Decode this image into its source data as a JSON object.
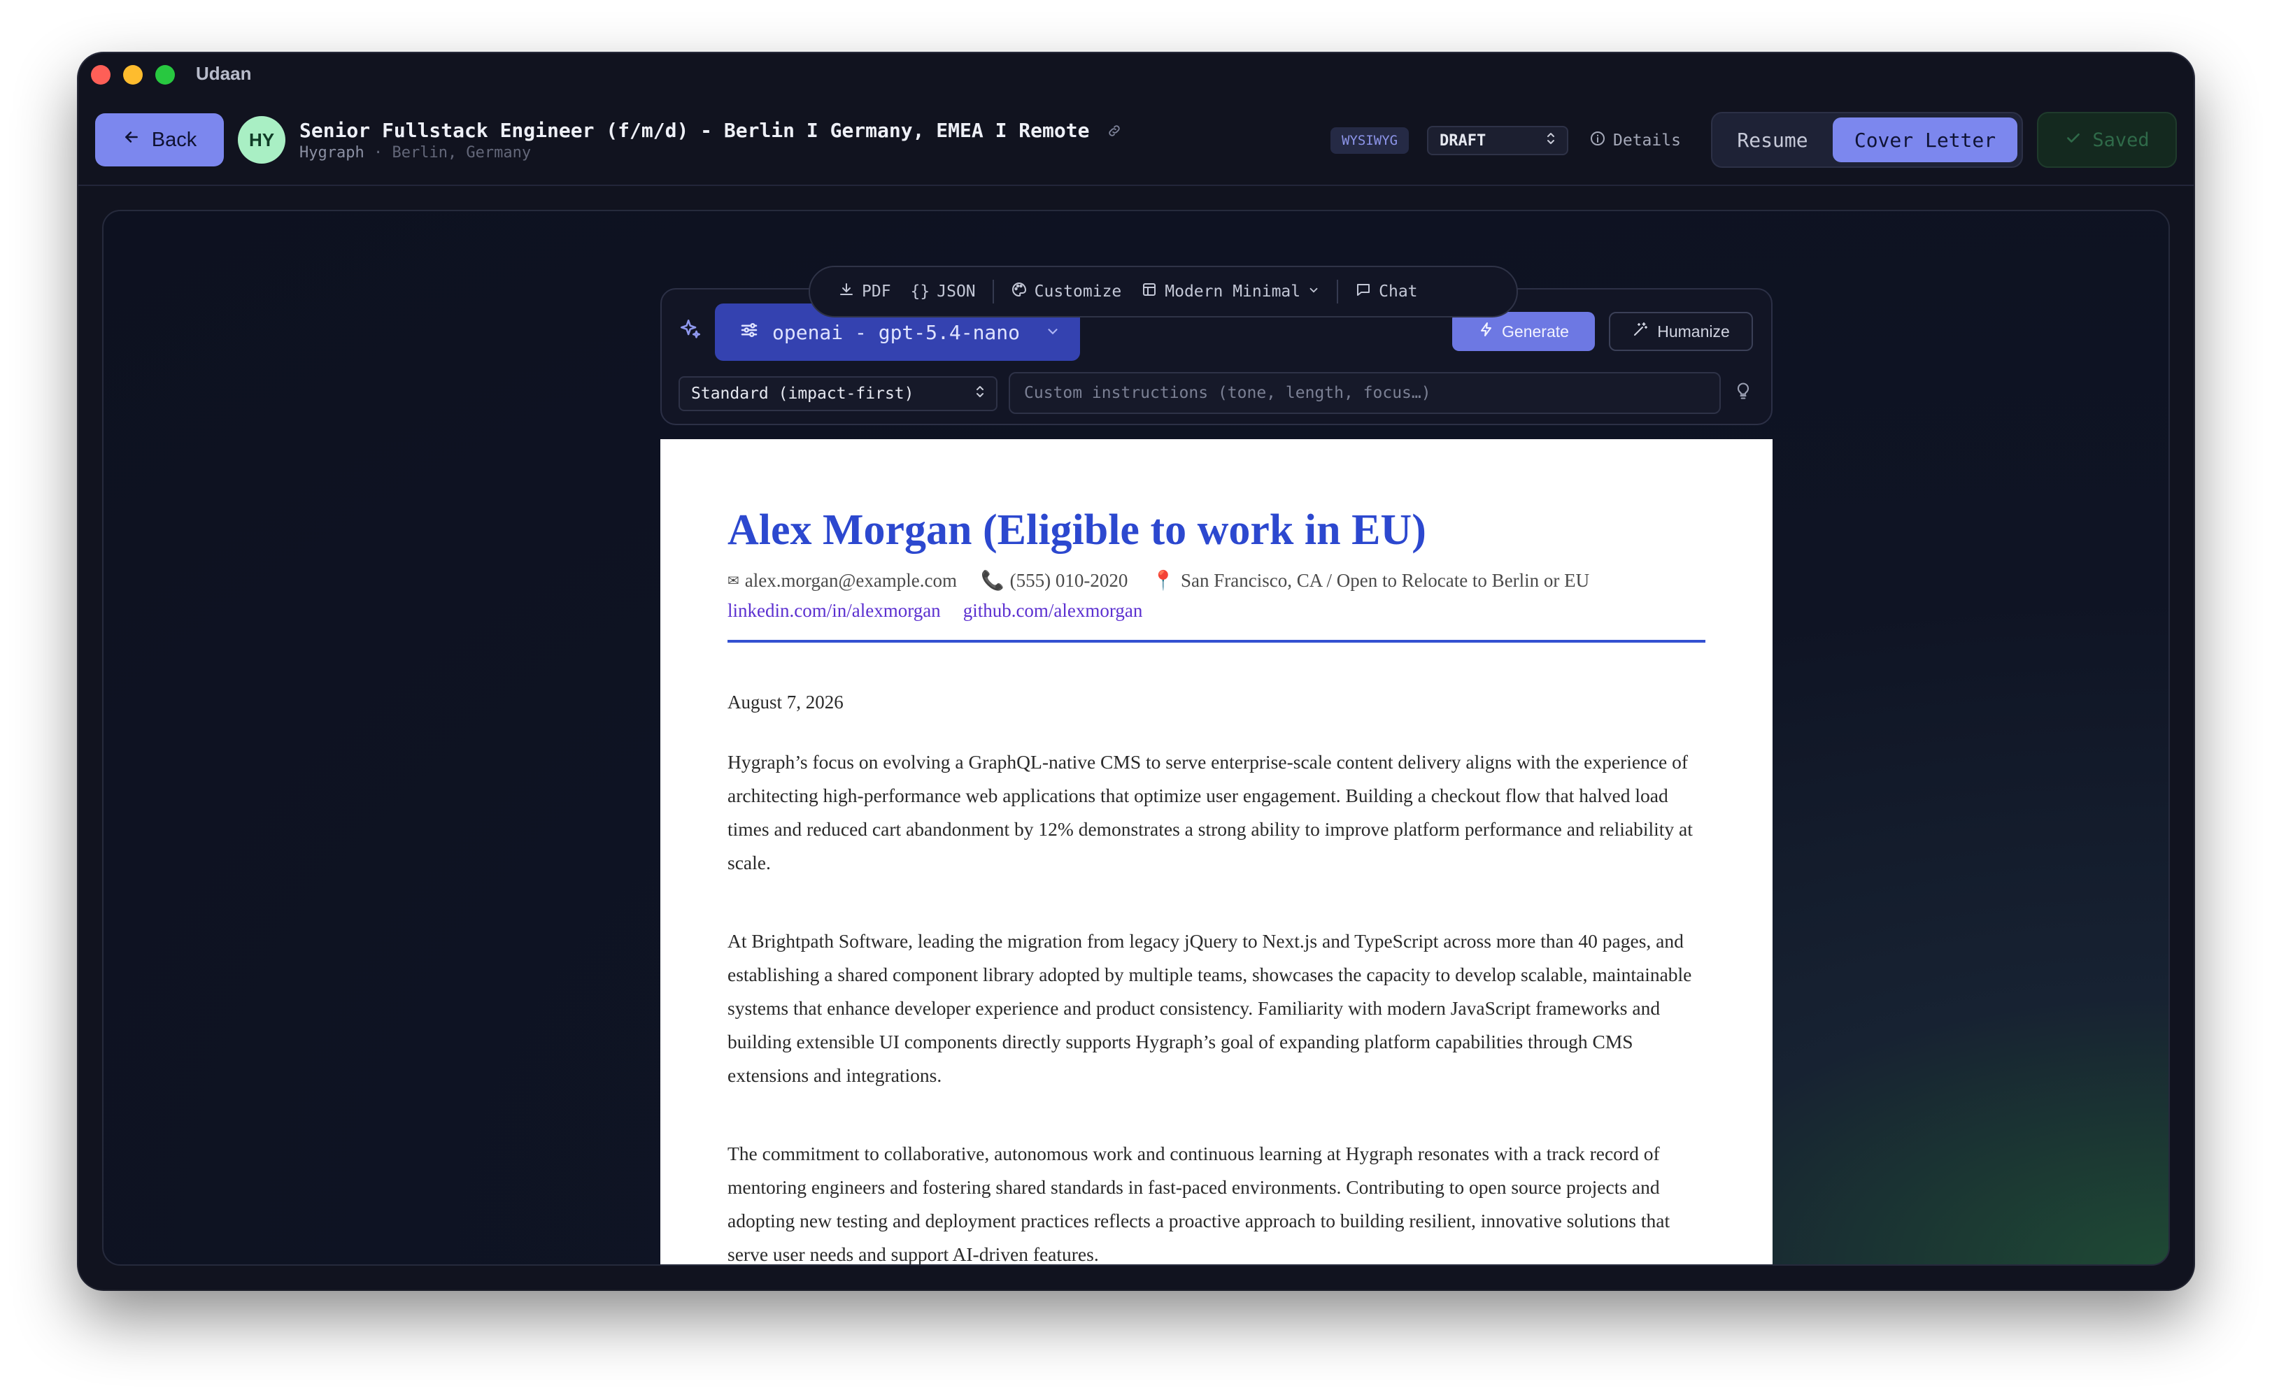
{
  "app": {
    "title": "Udaan"
  },
  "header": {
    "back_label": "Back",
    "avatar_initials": "HY",
    "job_title": "Senior Fullstack Engineer (f/m/d) - Berlin I Germany, EMEA I Remote",
    "company": "Hygraph",
    "location": "Berlin, Germany",
    "editor_mode": "WYSIWYG",
    "status": "DRAFT",
    "details_label": "Details",
    "tabs": [
      {
        "label": "Resume",
        "active": false
      },
      {
        "label": "Cover Letter",
        "active": true
      }
    ],
    "saved_label": "Saved"
  },
  "toolbar": {
    "pdf_label": "PDF",
    "json_label": "JSON",
    "customize_label": "Customize",
    "template_label": "Modern Minimal",
    "chat_label": "Chat"
  },
  "generator": {
    "model_label": "openai - gpt-5.4-nano",
    "generate_label": "Generate",
    "humanize_label": "Humanize",
    "style": "Standard (impact-first)",
    "instructions_placeholder": "Custom instructions (tone, length, focus…)"
  },
  "letter": {
    "name": "Alex Morgan (Eligible to work in EU)",
    "email": "alex.morgan@example.com",
    "phone": "(555) 010-2020",
    "location": "San Francisco, CA / Open to Relocate to Berlin or EU",
    "linkedin": "linkedin.com/in/alexmorgan",
    "github": "github.com/alexmorgan",
    "date": "August 7, 2026",
    "paragraphs": [
      "Hygraph’s focus on evolving a GraphQL-native CMS to serve enterprise-scale content delivery aligns with the experience of architecting high-performance web applications that optimize user engagement. Building a checkout flow that halved load times and reduced cart abandonment by 12% demonstrates a strong ability to improve platform performance and reliability at scale.",
      "At Brightpath Software, leading the migration from legacy jQuery to Next.js and TypeScript across more than 40 pages, and establishing a shared component library adopted by multiple teams, showcases the capacity to develop scalable, maintainable systems that enhance developer experience and product consistency. Familiarity with modern JavaScript frameworks and building extensible UI components directly supports Hygraph’s goal of expanding platform capabilities through CMS extensions and integrations.",
      "The commitment to collaborative, autonomous work and continuous learning at Hygraph resonates with a track record of mentoring engineers and fostering shared standards in fast-paced environments. Contributing to open source projects and adopting new testing and deployment practices reflects a proactive approach to building resilient, innovative solutions that serve user needs and support AI-driven features."
    ]
  },
  "icons": {
    "email": "✉",
    "phone": "📞",
    "location": "📍"
  },
  "colors": {
    "accent": "#7c87ee",
    "name_blue": "#2c48cf",
    "link_purple": "#5b2fd0",
    "avatar_green": "#a9efc4"
  }
}
